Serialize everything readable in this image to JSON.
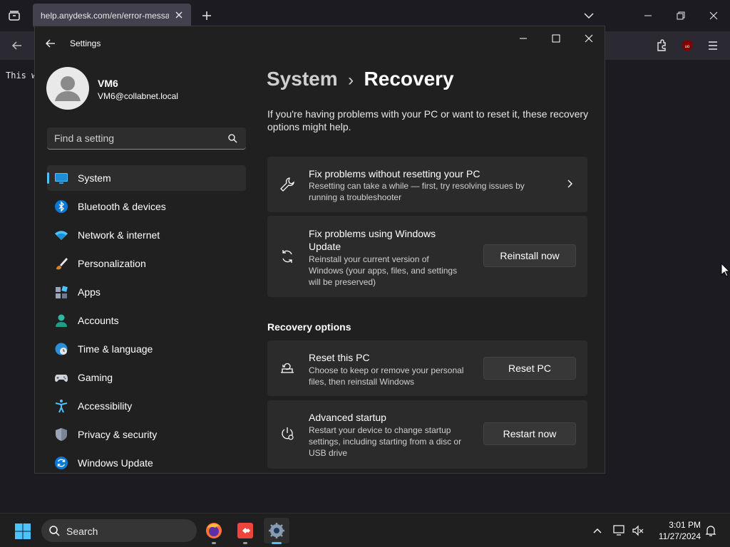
{
  "browser": {
    "tab_title": "help.anydesk.com/en/error-messages",
    "page_text": "This w"
  },
  "settings": {
    "window_title": "Settings",
    "user": {
      "name": "VM6",
      "email": "VM6@collabnet.local"
    },
    "search_placeholder": "Find a setting",
    "nav": [
      {
        "label": "System",
        "icon": "monitor-icon",
        "active": true
      },
      {
        "label": "Bluetooth & devices",
        "icon": "bluetooth-icon"
      },
      {
        "label": "Network & internet",
        "icon": "wifi-icon"
      },
      {
        "label": "Personalization",
        "icon": "brush-icon"
      },
      {
        "label": "Apps",
        "icon": "apps-icon"
      },
      {
        "label": "Accounts",
        "icon": "person-icon"
      },
      {
        "label": "Time & language",
        "icon": "globe-clock-icon"
      },
      {
        "label": "Gaming",
        "icon": "gamepad-icon"
      },
      {
        "label": "Accessibility",
        "icon": "accessibility-icon"
      },
      {
        "label": "Privacy & security",
        "icon": "shield-icon"
      },
      {
        "label": "Windows Update",
        "icon": "update-icon"
      }
    ],
    "breadcrumb": {
      "parent": "System",
      "separator": "›",
      "current": "Recovery"
    },
    "intro": "If you're having problems with your PC or want to reset it, these recovery options might help.",
    "cards": [
      {
        "title": "Fix problems without resetting your PC",
        "desc": "Resetting can take a while — first, try resolving issues by running a troubleshooter",
        "icon": "wrench-icon"
      },
      {
        "title": "Fix problems using Windows Update",
        "desc": "Reinstall your current version of Windows (your apps, files, and settings will be preserved)",
        "button": "Reinstall now",
        "icon": "sync-icon"
      }
    ],
    "section_header": "Recovery options",
    "recovery_options": [
      {
        "title": "Reset this PC",
        "desc": "Choose to keep or remove your personal files, then reinstall Windows",
        "button": "Reset PC",
        "icon": "reset-pc-icon"
      },
      {
        "title": "Advanced startup",
        "desc": "Restart your device to change startup settings, including starting from a disc or USB drive",
        "button": "Restart now",
        "icon": "advanced-startup-icon"
      }
    ]
  },
  "taskbar": {
    "search_label": "Search",
    "time": "3:01 PM",
    "date": "11/27/2024"
  },
  "colors": {
    "accent": "#4cc2ff",
    "window_bg": "#202020",
    "card_bg": "#2b2b2b"
  }
}
